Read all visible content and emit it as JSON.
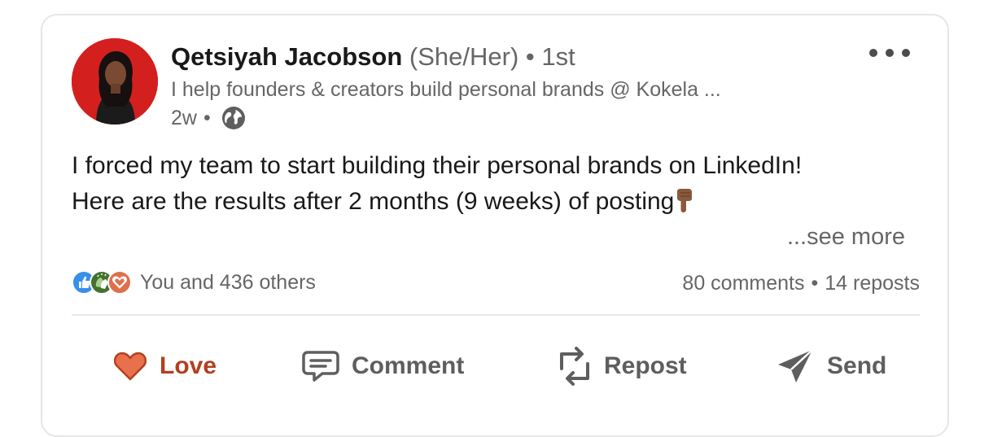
{
  "author": {
    "name": "Qetsiyah Jacobson",
    "pronouns": "(She/Her)",
    "separator": "•",
    "degree": "1st",
    "headline": "I help founders & creators build personal brands @ Kokela ...",
    "post_age": "2w",
    "visibility_icon": "globe-icon",
    "avatar_bg": "#d41f1f"
  },
  "post": {
    "line1": "I forced my team to start building their personal brands on LinkedIn!",
    "line2": "Here are the results after 2 months (9 weeks) of posting",
    "emoji_icon": "pointing-down-finger-icon",
    "see_more": "...see more"
  },
  "social": {
    "reaction_icons": [
      "like-icon",
      "celebrate-icon",
      "love-icon"
    ],
    "reactions_text": "You and 436 others",
    "comments": "80 comments",
    "separator": "•",
    "reposts": "14 reposts"
  },
  "actions": {
    "love": "Love",
    "comment": "Comment",
    "repost": "Repost",
    "send": "Send"
  },
  "colors": {
    "love_accent": "#b24020",
    "love_fill": "#e8704c",
    "like_blue": "#378fe9",
    "celebrate_green": "#44712e",
    "secondary_text": "#666666"
  }
}
